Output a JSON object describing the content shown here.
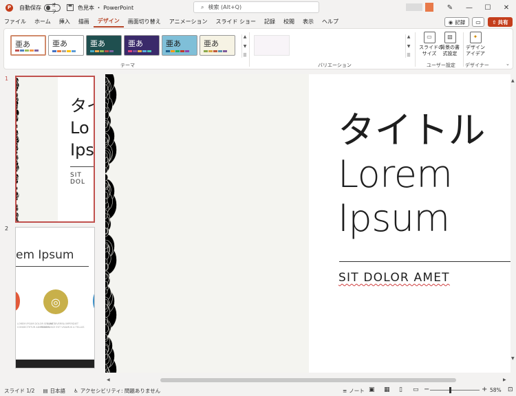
{
  "app": {
    "logo_letter": "P",
    "autosave_label": "自動保存",
    "autosave_state": "オフ",
    "doc_title": "色見本 ・ PowerPoint",
    "search_placeholder": "検索 (Alt+Q)",
    "accent": "#c43e1c"
  },
  "window_controls": {
    "minimize": "—",
    "maximize": "☐",
    "close": "✕"
  },
  "tabs": [
    {
      "label": "ファイル",
      "active": false
    },
    {
      "label": "ホーム",
      "active": false
    },
    {
      "label": "挿入",
      "active": false
    },
    {
      "label": "描画",
      "active": false
    },
    {
      "label": "デザイン",
      "active": true
    },
    {
      "label": "画面切り替え",
      "active": false
    },
    {
      "label": "アニメーション",
      "active": false
    },
    {
      "label": "スライド ショー",
      "active": false
    },
    {
      "label": "記録",
      "active": false
    },
    {
      "label": "校閲",
      "active": false
    },
    {
      "label": "表示",
      "active": false
    },
    {
      "label": "ヘルプ",
      "active": false
    }
  ],
  "header_buttons": {
    "record": "記録",
    "share": "共有"
  },
  "ribbon": {
    "themes": [
      {
        "text": "亜あ",
        "bg": "#ffffff",
        "fg": "#333333",
        "bars": [
          "#c0504d",
          "#4f81bd",
          "#9bbb59",
          "#f79646",
          "#8064a2"
        ],
        "selected": true
      },
      {
        "text": "亜あ",
        "bg": "#ffffff",
        "fg": "#333333",
        "bars": [
          "#4472c4",
          "#ed7d31",
          "#a5a5a5",
          "#ffc000",
          "#5b9bd5"
        ],
        "selected": false
      },
      {
        "text": "亜あ",
        "bg": "#1f4f4f",
        "fg": "#ffffff",
        "bars": [
          "#4bacc6",
          "#f0ad4e",
          "#9bbb59",
          "#c0504d",
          "#8064a2"
        ],
        "selected": false
      },
      {
        "text": "亜あ",
        "bg": "#3a2a6a",
        "fg": "#ffffff",
        "bars": [
          "#e0457b",
          "#7b4fa0",
          "#f5b041",
          "#5dade2",
          "#48c9b0"
        ],
        "selected": false
      },
      {
        "text": "亜あ",
        "bg": "#7fbfd8",
        "fg": "#1a1a1a",
        "bars": [
          "#1f5f8b",
          "#f39c12",
          "#27ae60",
          "#c0392b",
          "#8e44ad"
        ],
        "selected": false
      },
      {
        "text": "亜あ",
        "bg": "#f6f3e4",
        "fg": "#333333",
        "bars": [
          "#8aa84b",
          "#d9a441",
          "#c05a3c",
          "#5a8fb0",
          "#7d5a9c"
        ],
        "selected": false
      }
    ],
    "group_theme": "テーマ",
    "group_variation": "バリエーション",
    "group_user": "ユーザー設定",
    "group_designer": "デザイナー",
    "slide_size": "スライドの\nサイズ",
    "bg_format": "背景の書\n式設定",
    "design_ideas": "デザイン\nアイデア"
  },
  "thumbnails": [
    {
      "number": "1",
      "title": "タイ\nLo\nIps",
      "subtitle": "SIT DOL"
    },
    {
      "number": "2",
      "title": "em Ipsum",
      "caption_left": "LOREM IPSUM DOLOR SIT AMET\nCONSECTETUR ADIPISCING",
      "caption_right": "NUNC VIVERRA IMPERDIET\nENIM FUSCE EST VIVAMUS A TELLUS"
    }
  ],
  "slide": {
    "title": "タイトル\nLorem\nIpsum",
    "subtitle": "SIT DOLOR AMET"
  },
  "status": {
    "slide_indicator": "スライド 1/2",
    "language": "日本語",
    "accessibility": "アクセシビリティ: 問題ありません",
    "notes": "ノート",
    "zoom": "58%"
  }
}
